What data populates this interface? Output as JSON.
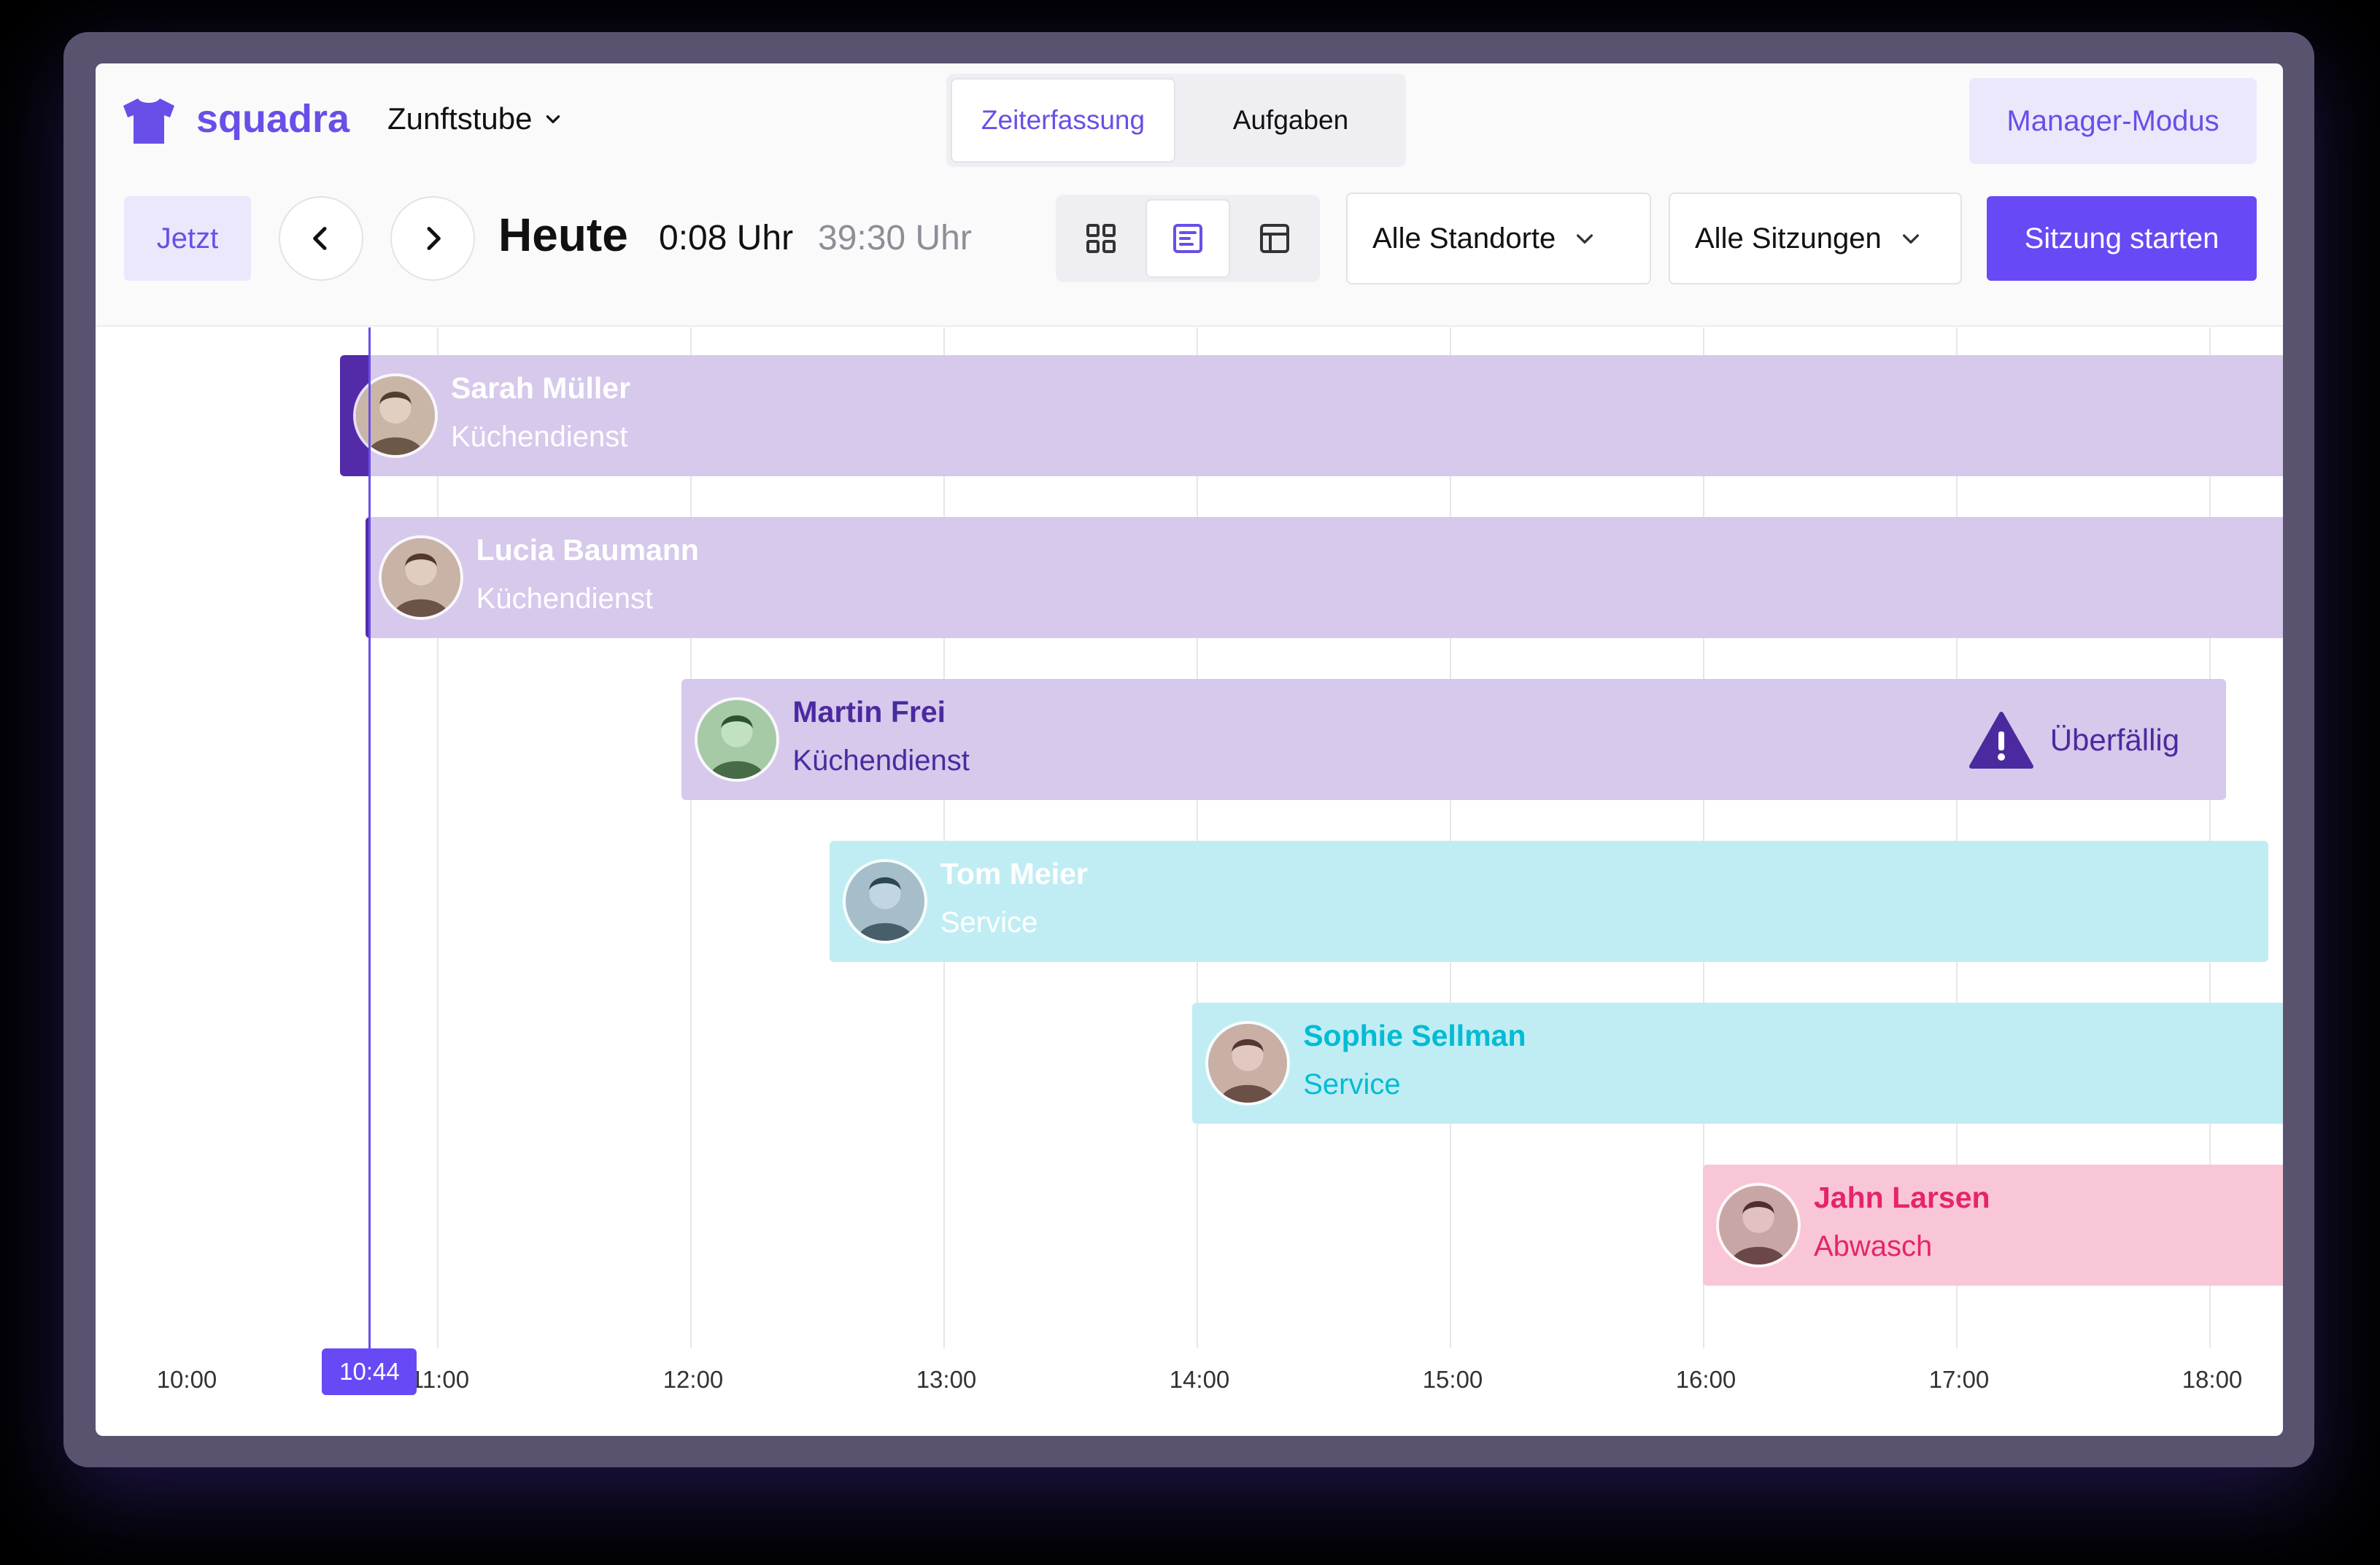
{
  "app": {
    "brand": "squadra",
    "workspace": "Zunftstube",
    "tabs": [
      {
        "label": "Zeiterfassung",
        "active": true
      },
      {
        "label": "Aufgaben",
        "active": false
      }
    ],
    "manager_mode": "Manager-Modus",
    "accent_color": "#6849f5"
  },
  "toolbar": {
    "now_label": "Jetzt",
    "prev_icon": "chevron-left-icon",
    "next_icon": "chevron-right-icon",
    "day_label": "Heute",
    "current_time": "0:08 Uhr",
    "total_time": "39:30 Uhr",
    "view_modes": [
      {
        "icon": "grid-view-icon",
        "active": false
      },
      {
        "icon": "timeline-view-icon",
        "active": true
      },
      {
        "icon": "table-view-icon",
        "active": false
      }
    ],
    "location_filter": "Alle Standorte",
    "session_filter": "Alle Sitzungen",
    "start_session": "Sitzung starten"
  },
  "timeline": {
    "hours": [
      "10:00",
      "11:00",
      "12:00",
      "13:00",
      "14:00",
      "15:00",
      "16:00",
      "17:00",
      "18:00"
    ],
    "now": "10:44",
    "shifts": [
      {
        "name": "Sarah Müller",
        "role": "Küchendienst",
        "start": "10:37",
        "end": "19:30",
        "color": "#532aa8",
        "light": "#d6c9eb",
        "text": "#ffffff"
      },
      {
        "name": "Lucia Baumann",
        "role": "Küchendienst",
        "start": "10:43",
        "end": "19:30",
        "color": "#532aa8",
        "light": "#d6c9eb",
        "text": "#ffffff"
      },
      {
        "name": "Martin Frei",
        "role": "Küchendienst",
        "start": "11:58",
        "end": "18:04",
        "color": null,
        "light": "#d6c9eb",
        "text": "#4b2aa0",
        "status": "Überfällig",
        "status_icon": "warning-icon"
      },
      {
        "name": "Tom Meier",
        "role": "Service",
        "start": "12:33",
        "end": "18:14",
        "color": "#00bcd4",
        "light": "#c0edf3",
        "text": "#ffffff"
      },
      {
        "name": "Sophie Sellman",
        "role": "Service",
        "start": "13:59",
        "end": "19:30",
        "color": null,
        "light": "#c0edf3",
        "text": "#00bcd4"
      },
      {
        "name": "Jahn Larsen",
        "role": "Abwasch",
        "start": "16:00",
        "end": "19:30",
        "color": null,
        "light": "#f9c6d8",
        "text": "#e6246a"
      }
    ]
  }
}
